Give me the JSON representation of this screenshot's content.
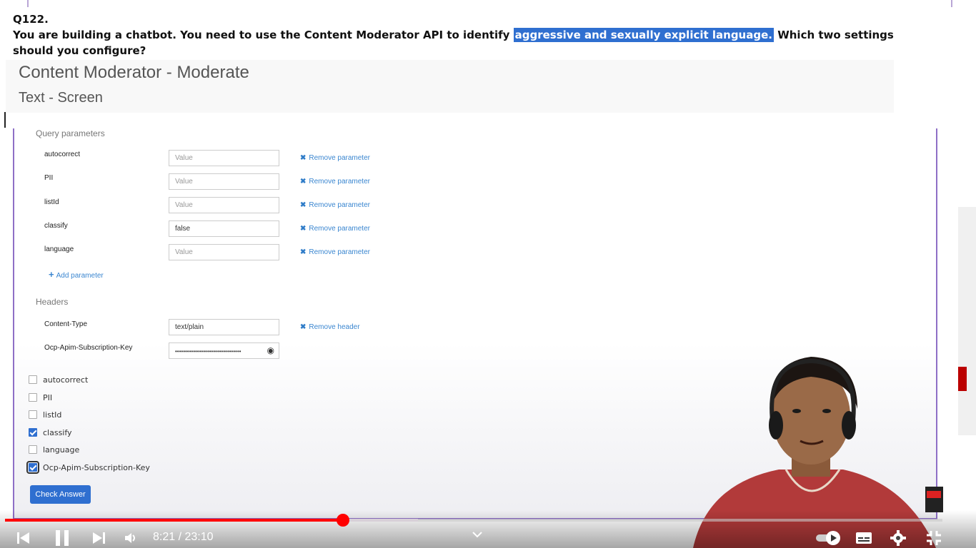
{
  "question": {
    "number": "Q122.",
    "text_before": "You are building a chatbot. You need to use the Content Moderator API to identify ",
    "highlighted": "aggressive and sexually explicit language.",
    "text_after": " Which two settings should you configure?"
  },
  "api": {
    "title": "Content Moderator - Moderate",
    "subtitle": "Text - Screen"
  },
  "query_parameters": {
    "label": "Query parameters",
    "items": [
      {
        "name": "autocorrect",
        "value": "",
        "placeholder": "Value",
        "remove": "Remove parameter"
      },
      {
        "name": "PII",
        "value": "",
        "placeholder": "Value",
        "remove": "Remove parameter"
      },
      {
        "name": "listId",
        "value": "",
        "placeholder": "Value",
        "remove": "Remove parameter"
      },
      {
        "name": "classify",
        "value": "false",
        "placeholder": "Value",
        "remove": "Remove parameter"
      },
      {
        "name": "language",
        "value": "",
        "placeholder": "Value",
        "remove": "Remove parameter"
      }
    ],
    "add_label": "Add parameter"
  },
  "headers": {
    "label": "Headers",
    "items": [
      {
        "name": "Content-Type",
        "value": "text/plain",
        "remove": "Remove header"
      },
      {
        "name": "Ocp-Apim-Subscription-Key",
        "value": "•••••••••••••••••••••••••••••••••"
      }
    ]
  },
  "answer_options": [
    {
      "label": "autocorrect",
      "checked": false
    },
    {
      "label": "PII",
      "checked": false
    },
    {
      "label": "listId",
      "checked": false
    },
    {
      "label": "classify",
      "checked": true
    },
    {
      "label": "language",
      "checked": false
    },
    {
      "label": "Ocp-Apim-Subscription-Key",
      "checked": true
    }
  ],
  "check_button": "Check Answer",
  "player": {
    "time": "8:21 / 23:10",
    "progress": 0.3605,
    "buffered": 0.4403,
    "colors": {
      "progress": "#ff0000",
      "accent": "#2f6fd0"
    }
  },
  "icons": [
    "remove-x-icon",
    "add-plus-icon",
    "eye-icon",
    "skip-previous-icon",
    "pause-icon",
    "skip-next-icon",
    "volume-icon",
    "chevron-down-icon",
    "autoplay-toggle-icon",
    "captions-icon",
    "settings-gear-icon",
    "exit-fullscreen-icon"
  ]
}
